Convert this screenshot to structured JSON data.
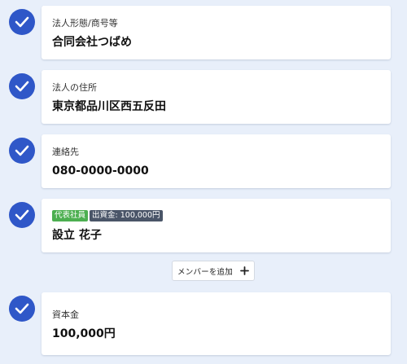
{
  "accent_color": "#2f57c8",
  "fields": [
    {
      "label": "法人形態/商号等",
      "value": "合同会社つばめ"
    },
    {
      "label": "法人の住所",
      "value": "東京都品川区西五反田"
    },
    {
      "label": "連絡先",
      "value": "080-0000-0000"
    },
    {
      "value": "設立 花子"
    },
    {
      "label": "資本金",
      "value": "100,000円"
    }
  ],
  "member": {
    "role_badge": "代表社員",
    "investment_badge": "出資金: 100,000円"
  },
  "add_member": {
    "label": "メンバーを追加",
    "icon": "plus-icon"
  }
}
